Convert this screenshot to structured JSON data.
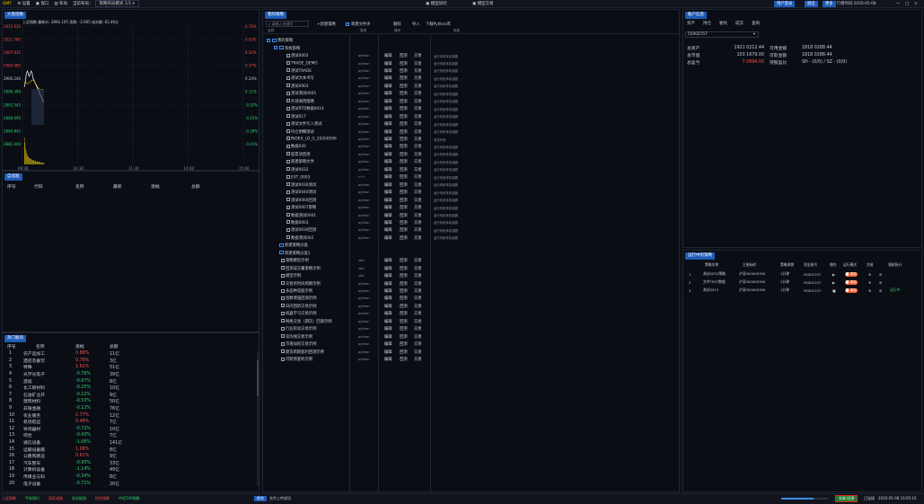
{
  "topbar": {
    "logo": "QMT",
    "items": [
      "设置",
      "窗口",
      "布局",
      "当前布局：",
      "策略布局模式 1/1"
    ],
    "center_left": "模型研究",
    "center_right": "模型交易",
    "right_buttons": [
      "用户登录",
      "退出",
      "更多"
    ],
    "time_label": "行情时间:2020-05-08",
    "window_ctrls": [
      "一",
      "□",
      "×"
    ]
  },
  "chart_panel": {
    "tab": "大盘指数",
    "header": "上证指数  最新价: 2892.105  涨跌: -2.695  成交额: 65.46亿",
    "y_left": [
      "2915.630",
      "2911.780",
      "2907.935",
      "2904.085",
      "2900.240",
      "2896.390",
      "2892.545",
      "2888.695",
      "2884.845",
      "2881.000"
    ],
    "y_right": [
      "0.76%",
      "0.63%",
      "0.50%",
      "0.37%",
      "0.24%",
      "0.11%",
      "-0.02%",
      "-0.15%",
      "-0.28%",
      "-0.41%"
    ],
    "x_labels": [
      "09:30",
      "10:30",
      "11:30",
      "14:00",
      "15:00"
    ]
  },
  "watchlist": {
    "tab": "自选股",
    "headers": [
      "序号",
      "代码",
      "名称",
      "最新",
      "涨幅",
      "总额"
    ]
  },
  "sectors": {
    "tab": "热门板块",
    "headers": [
      "序号",
      "名称",
      "涨幅",
      "总额"
    ],
    "rows": [
      {
        "i": "1",
        "n": "农产品加工",
        "c": "0.88%",
        "t": "11亿",
        "up": true
      },
      {
        "i": "2",
        "n": "酒店及餐饮",
        "c": "0.78%",
        "t": "3亿",
        "up": true
      },
      {
        "i": "3",
        "n": "特殊",
        "c": "1.62%",
        "t": "51亿",
        "up": true
      },
      {
        "i": "4",
        "n": "光学光电子",
        "c": "-0.76%",
        "t": "39亿",
        "up": false
      },
      {
        "i": "5",
        "n": "造纸",
        "c": "-0.67%",
        "t": "8亿",
        "up": false
      },
      {
        "i": "6",
        "n": "化工新材料",
        "c": "-0.25%",
        "t": "10亿",
        "up": false
      },
      {
        "i": "7",
        "n": "石油矿业开",
        "c": "-0.22%",
        "t": "9亿",
        "up": false
      },
      {
        "i": "8",
        "n": "建筑材料",
        "c": "-0.53%",
        "t": "50亿",
        "up": false
      },
      {
        "i": "9",
        "n": "非银金融",
        "c": "-0.12%",
        "t": "76亿",
        "up": false
      },
      {
        "i": "10",
        "n": "农业服务",
        "c": "2.77%",
        "t": "12亿",
        "up": true
      },
      {
        "i": "11",
        "n": "机场航运",
        "c": "0.48%",
        "t": "7亿",
        "up": true
      },
      {
        "i": "12",
        "n": "休闲器材",
        "c": "-0.72%",
        "t": "10亿",
        "up": false
      },
      {
        "i": "13",
        "n": "综合",
        "c": "-0.43%",
        "t": "7亿",
        "up": false
      },
      {
        "i": "14",
        "n": "通信设备",
        "c": "-1.06%",
        "t": "141亿",
        "up": false
      },
      {
        "i": "15",
        "n": "运输设备服",
        "c": "1.08%",
        "t": "8亿",
        "up": true
      },
      {
        "i": "16",
        "n": "公路铁路运",
        "c": "0.61%",
        "t": "9亿",
        "up": true
      },
      {
        "i": "17",
        "n": "汽车整车",
        "c": "-0.95%",
        "t": "33亿",
        "up": false
      },
      {
        "i": "18",
        "n": "计算机设备",
        "c": "-1.14%",
        "t": "49亿",
        "up": false
      },
      {
        "i": "19",
        "n": "传媒业与科",
        "c": "-0.34%",
        "t": "8亿",
        "up": false
      },
      {
        "i": "20",
        "n": "电子设备",
        "c": "-0.71%",
        "t": "20亿",
        "up": false
      }
    ]
  },
  "strategy": {
    "tab": "我的策略",
    "search": "请输入关键字",
    "buttons": [
      "+新建策略",
      "新建文件夹",
      "删除",
      "导入",
      "下载Python库"
    ],
    "col_headers": [
      "名称",
      "类型",
      "操作",
      "描述"
    ],
    "ops": [
      "编辑",
      "回测",
      "交易"
    ],
    "root": "我的策略",
    "group1": "系统策略",
    "group2": "新建策略分类",
    "group3": "新建策略分类1",
    "items": [
      {
        "n": "测试0002",
        "t": "python",
        "d": "运行系统本机函数"
      },
      {
        "n": "TRADE_DEMO",
        "t": "python",
        "d": "运行系统本机函数"
      },
      {
        "n": "测试TRADE",
        "t": "python",
        "d": "运行系统本机函数"
      },
      {
        "n": "测试文本书写",
        "t": "python",
        "d": "运行系统本机函数"
      },
      {
        "n": "测试0003",
        "t": "python",
        "d": "运行系统本机函数"
      },
      {
        "n": "测试测试0005",
        "t": "python",
        "d": "运行系统本机函数"
      },
      {
        "n": "外部调用策略",
        "t": "python",
        "d": "运行系统本机函数"
      },
      {
        "n": "测试RTD数据0014",
        "t": "python",
        "d": "运行系统本机函数"
      },
      {
        "n": "测试017",
        "t": "python",
        "d": "运行系统本机函数"
      },
      {
        "n": "测试文件写入测试",
        "t": "python",
        "d": "运行系统本机函数"
      },
      {
        "n": "持仓明细测试",
        "t": "python",
        "d": "运行系统本机函数"
      },
      {
        "n": "INDEX_LO_G_20200506",
        "t": "python",
        "d": "测试代码"
      },
      {
        "n": "数据020",
        "t": "python",
        "d": "运行系统本机函数"
      },
      {
        "n": "股票池回测",
        "t": "python",
        "d": "运行系统本机函数"
      },
      {
        "n": "新建策略文件",
        "t": "python",
        "d": "运行系统本机函数"
      },
      {
        "n": "测试0032",
        "t": "python",
        "d": "运行系统本机函数"
      },
      {
        "n": "EXT_0003",
        "t": "c++",
        "d": "运行系统本机函数"
      },
      {
        "n": "测试0030测试",
        "t": "python",
        "d": "运行系统本机函数"
      },
      {
        "n": "测试0040测试",
        "t": "python",
        "d": "运行系统本机函数"
      },
      {
        "n": "测试0060回测",
        "t": "python",
        "d": "运行系统本机函数"
      },
      {
        "n": "测试0007策略",
        "t": "python",
        "d": "运行系统本机函数"
      },
      {
        "n": "数据测试0001",
        "t": "python",
        "d": "运行系统本机函数"
      },
      {
        "n": "数据0003",
        "t": "python",
        "d": "运行系统本机函数"
      },
      {
        "n": "测试0030回测",
        "t": "python",
        "d": "运行系统本机函数"
      },
      {
        "n": "数据测试002",
        "t": "python",
        "d": "运行系统本机函数"
      }
    ],
    "items2": [
      {
        "n": "策略模型示例",
        "t": "vba",
        "d": ""
      },
      {
        "n": "回测成交量策略示例",
        "t": "vba",
        "d": ""
      },
      {
        "n": "模型示例",
        "t": "vba",
        "d": ""
      },
      {
        "n": "交易所时间周期示例",
        "t": "python",
        "d": ""
      },
      {
        "n": "多品种选股示例",
        "t": "python",
        "d": ""
      },
      {
        "n": "指数增强回测示例",
        "t": "python",
        "d": ""
      },
      {
        "n": "日内回转交易示例",
        "t": "python",
        "d": ""
      },
      {
        "n": "机器学习交易示例",
        "t": "python",
        "d": ""
      },
      {
        "n": "网格交易（期货）回测示例",
        "t": "python",
        "d": ""
      },
      {
        "n": "行业轮动交易示例",
        "t": "python",
        "d": ""
      },
      {
        "n": "双均线交易示例",
        "t": "python",
        "d": ""
      },
      {
        "n": "市值加权交易示例",
        "t": "python",
        "d": ""
      },
      {
        "n": "期货跨期套利回测示例",
        "t": "python",
        "d": ""
      },
      {
        "n": "可转债套利示例",
        "t": "python",
        "d": ""
      }
    ]
  },
  "account": {
    "tab": "账户信息",
    "tabs": [
      "资产",
      "持仓",
      "委托",
      "成交",
      "查询"
    ],
    "account_id": "55002157",
    "fields": [
      {
        "l1": "总资产",
        "v1": "1921 0212.44",
        "l2": "可用金额",
        "v2": "1818 0288.44"
      },
      {
        "l1": "总市值",
        "v1": "103 1679.00",
        "l2": "可取金额",
        "v2": "1818 0288.44"
      },
      {
        "l1": "总盈亏",
        "v1": "7 0694.00",
        "l2": "持股盈比",
        "v2": "SH - (0/0) / SZ - (0/0)"
      }
    ]
  },
  "running": {
    "tab": "运行中的策略",
    "headers": [
      "策略名称",
      "主图标的",
      "策略周期",
      "资金账号",
      "操作",
      "运行模式",
      "交易",
      "强制拆分"
    ],
    "rows": [
      {
        "i": "1",
        "n": "测试0032策略",
        "s": "沪深300000300",
        "p": "1分钟",
        "a": "55002157",
        "m": "模拟"
      },
      {
        "i": "2",
        "n": "文件TEST数据",
        "s": "沪深300000300",
        "p": "1分钟",
        "a": "55002157",
        "m": "模拟"
      },
      {
        "i": "3",
        "n": "测试0013",
        "s": "沪深300000300",
        "p": "1分钟",
        "a": "55002157",
        "m": "模拟"
      }
    ],
    "status3": "运行中"
  },
  "status": {
    "items": [
      "上证指数",
      "平安银行",
      "深证成指",
      "创业板指",
      "恒生指数",
      "中证500指数"
    ],
    "active_tab": "综合",
    "progress_text": "文件上传成功",
    "latency": "已连接",
    "clock": "2020-05-08 16:05:16",
    "trade_btn": "交易  回测"
  }
}
